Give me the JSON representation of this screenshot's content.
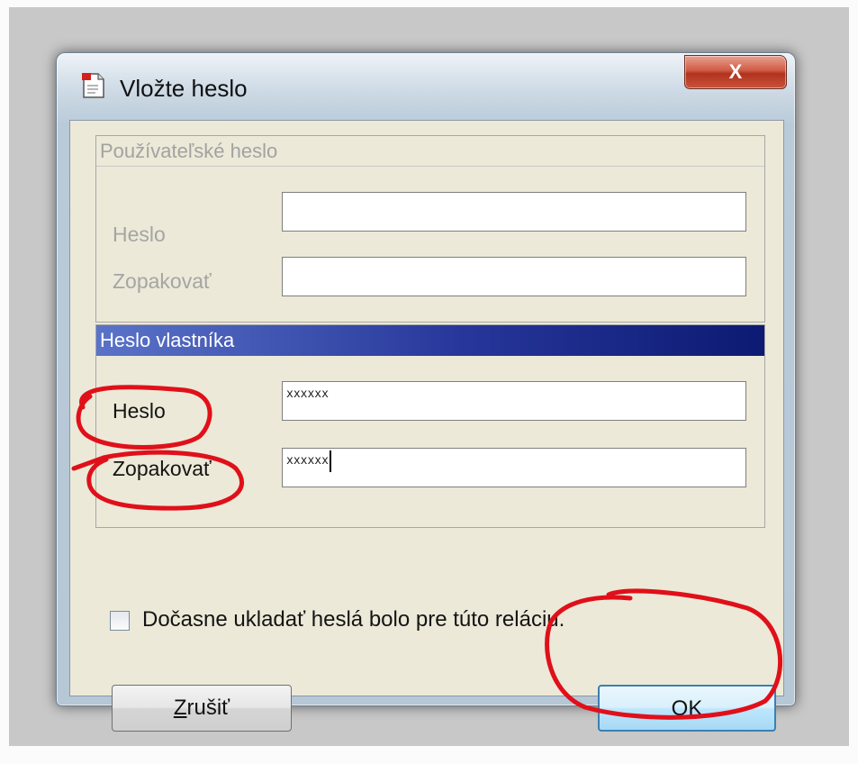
{
  "window": {
    "title": "Vložte heslo",
    "close_label": "X"
  },
  "user_password_group": {
    "title": "Používateľské heslo",
    "password_label": "Heslo",
    "repeat_label": "Zopakovať",
    "password_value": "",
    "repeat_value": ""
  },
  "owner_password_group": {
    "title": "Heslo vlastníka",
    "password_label": "Heslo",
    "repeat_label": "Zopakovať",
    "password_value": "xxxxxx",
    "repeat_value": "xxxxxx"
  },
  "options": {
    "remember_label": "Dočasne ukladať heslá bolo pre túto reláciu.",
    "remember_checked": false
  },
  "buttons": {
    "cancel_mnemonic": "Z",
    "cancel_rest": "rušiť",
    "ok_mnemonic": "O",
    "ok_rest": "K"
  },
  "colors": {
    "annotation": "#e0101a",
    "owner_header_start": "#5a73c8",
    "owner_header_end": "#0d1a73"
  }
}
